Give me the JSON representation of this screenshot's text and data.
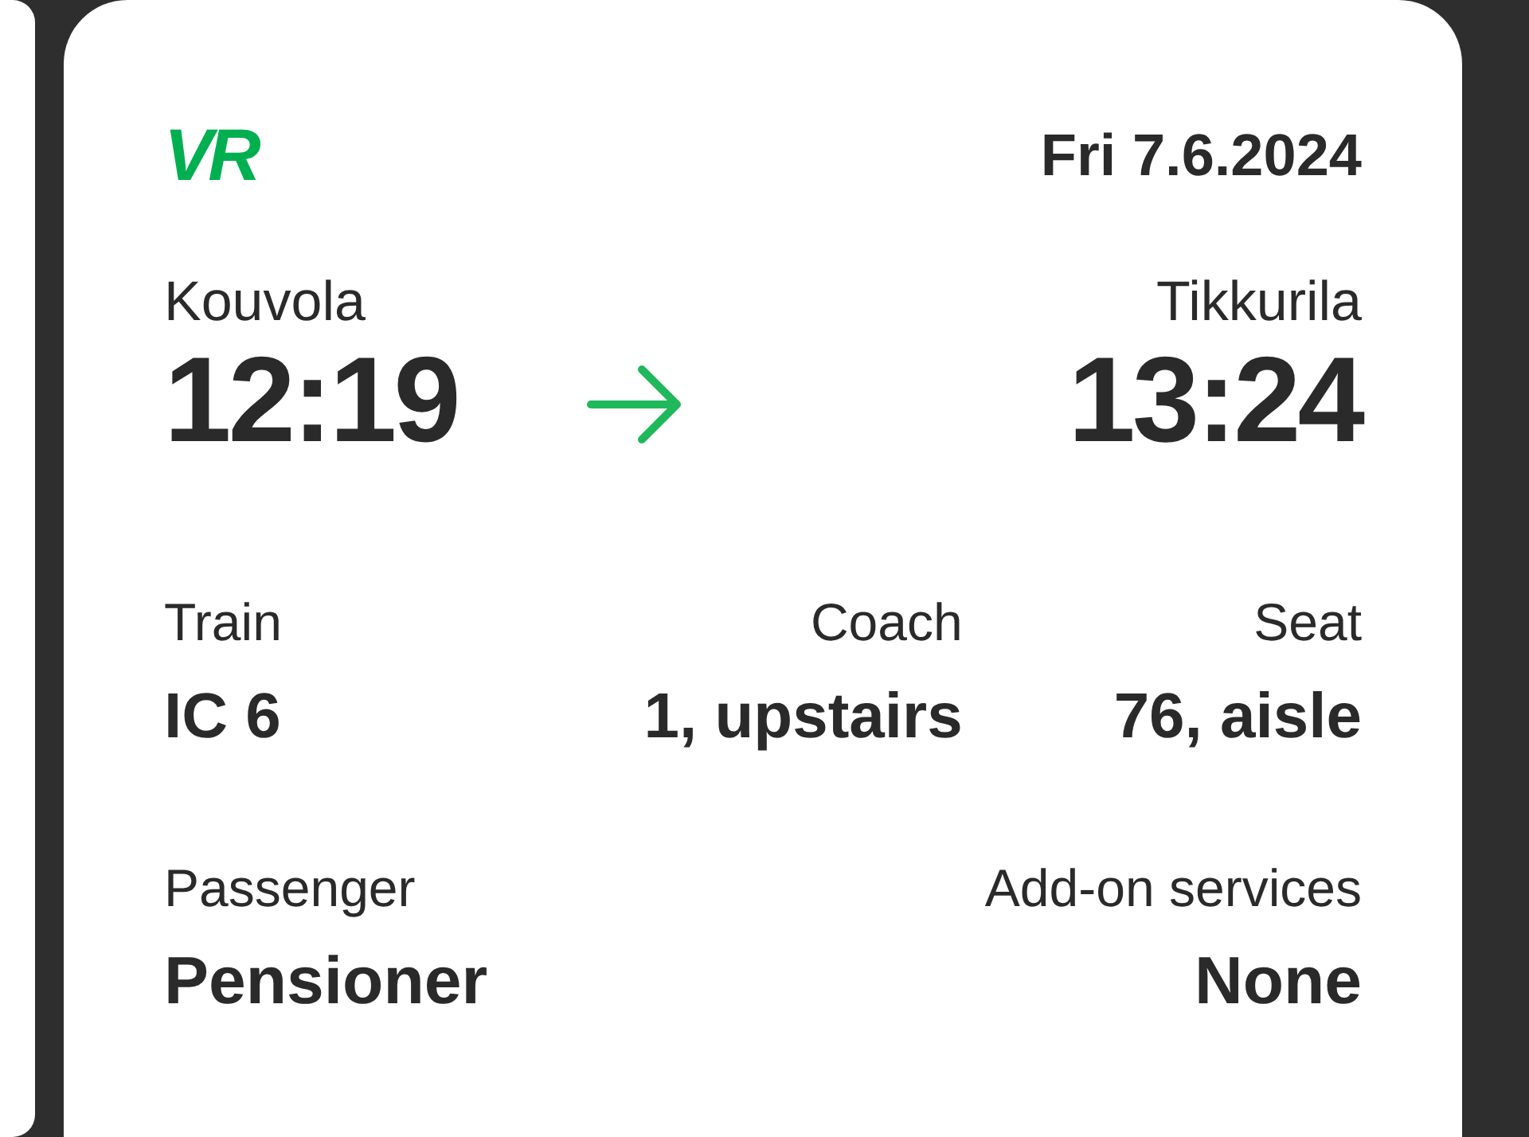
{
  "ticket": {
    "logo": "VR",
    "date": "Fri 7.6.2024",
    "departure": {
      "station": "Kouvola",
      "time": "12:19"
    },
    "arrival": {
      "station": "Tikkurila",
      "time": "13:24"
    },
    "details": [
      {
        "label": "Train",
        "value": "IC 6"
      },
      {
        "label": "Coach",
        "value": "1, upstairs"
      },
      {
        "label": "Seat",
        "value": "76, aisle"
      }
    ],
    "extras": [
      {
        "label": "Passenger",
        "value": "Pensioner"
      },
      {
        "label": "Add-on services",
        "value": "None"
      }
    ]
  }
}
